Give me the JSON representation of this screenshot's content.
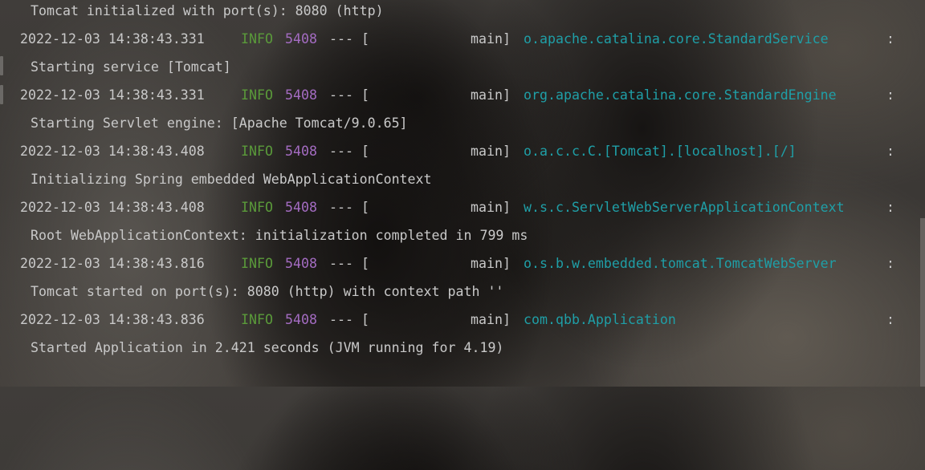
{
  "console": {
    "first_line": "Tomcat initialized with port(s): 8080 (http)",
    "entries": [
      {
        "timestamp": "2022-12-03 14:38:43.331",
        "level": "INFO",
        "pid": "5408",
        "separator": "--- [",
        "thread": "main]",
        "logger": "o.apache.catalina.core.StandardService",
        "colon": ":",
        "message": "Starting service [Tomcat]"
      },
      {
        "timestamp": "2022-12-03 14:38:43.331",
        "level": "INFO",
        "pid": "5408",
        "separator": "--- [",
        "thread": "main]",
        "logger": "org.apache.catalina.core.StandardEngine",
        "colon": ":",
        "message": "Starting Servlet engine: [Apache Tomcat/9.0.65]"
      },
      {
        "timestamp": "2022-12-03 14:38:43.408",
        "level": "INFO",
        "pid": "5408",
        "separator": "--- [",
        "thread": "main]",
        "logger": "o.a.c.c.C.[Tomcat].[localhost].[/]",
        "colon": ":",
        "message": "Initializing Spring embedded WebApplicationContext"
      },
      {
        "timestamp": "2022-12-03 14:38:43.408",
        "level": "INFO",
        "pid": "5408",
        "separator": "--- [",
        "thread": "main]",
        "logger": "w.s.c.ServletWebServerApplicationContext",
        "colon": ":",
        "message": "Root WebApplicationContext: initialization completed in 799 ms"
      },
      {
        "timestamp": "2022-12-03 14:38:43.816",
        "level": "INFO",
        "pid": "5408",
        "separator": "--- [",
        "thread": "main]",
        "logger": "o.s.b.w.embedded.tomcat.TomcatWebServer",
        "colon": ":",
        "message": "Tomcat started on port(s): 8080 (http) with context path ''"
      },
      {
        "timestamp": "2022-12-03 14:38:43.836",
        "level": "INFO",
        "pid": "5408",
        "separator": "--- [",
        "thread": "main]",
        "logger": "com.qbb.Application",
        "colon": ":",
        "message": "Started Application in 2.421 seconds (JVM running for 4.19)"
      }
    ]
  },
  "colors": {
    "text": "#c9c9c9",
    "level_info": "#5a9a3a",
    "pid": "#a46cc2",
    "logger": "#1f9fa7"
  }
}
